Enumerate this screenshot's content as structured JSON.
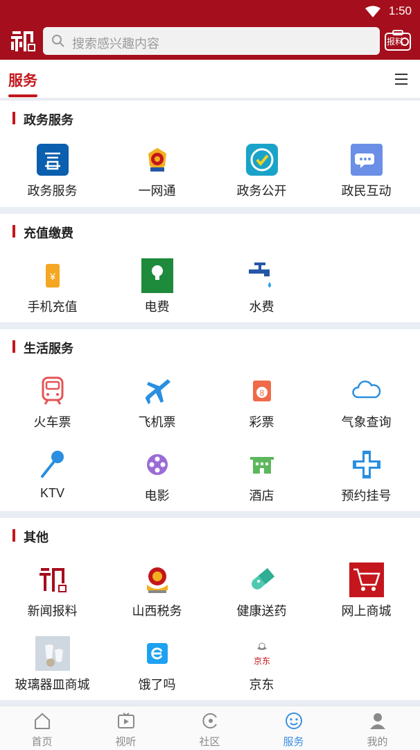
{
  "status": {
    "time": "1:50"
  },
  "header": {
    "search_placeholder": "搜索感兴趣内容",
    "report_label": "报料"
  },
  "tab": {
    "label": "服务"
  },
  "sections": [
    {
      "title": "政务服务",
      "items": [
        {
          "label": "政务服务",
          "icon": "gov-service-icon"
        },
        {
          "label": "一网通",
          "icon": "police-badge-icon"
        },
        {
          "label": "政务公开",
          "icon": "check-circle-icon"
        },
        {
          "label": "政民互动",
          "icon": "chat-bubble-icon"
        }
      ]
    },
    {
      "title": "充值缴费",
      "items": [
        {
          "label": "手机充值",
          "icon": "phone-recharge-icon"
        },
        {
          "label": "电费",
          "icon": "electric-bulb-icon",
          "sub": "电费"
        },
        {
          "label": "水费",
          "icon": "water-tap-icon"
        }
      ]
    },
    {
      "title": "生活服务",
      "items": [
        {
          "label": "火车票",
          "icon": "train-icon"
        },
        {
          "label": "飞机票",
          "icon": "airplane-icon"
        },
        {
          "label": "彩票",
          "icon": "lottery-icon"
        },
        {
          "label": "气象查询",
          "icon": "cloud-icon"
        },
        {
          "label": "KTV",
          "icon": "microphone-icon"
        },
        {
          "label": "电影",
          "icon": "film-reel-icon"
        },
        {
          "label": "酒店",
          "icon": "hotel-icon"
        },
        {
          "label": "预约挂号",
          "icon": "medical-cross-icon"
        }
      ]
    },
    {
      "title": "其他",
      "items": [
        {
          "label": "新闻报料",
          "icon": "news-logo-icon"
        },
        {
          "label": "山西税务",
          "icon": "tax-emblem-icon"
        },
        {
          "label": "健康送药",
          "icon": "pill-icon"
        },
        {
          "label": "网上商城",
          "icon": "shopping-cart-icon"
        },
        {
          "label": "玻璃器皿商城",
          "icon": "glassware-photo-icon"
        },
        {
          "label": "饿了吗",
          "icon": "eleme-icon"
        },
        {
          "label": "京东",
          "icon": "jd-dog-icon",
          "sub": "京东"
        }
      ]
    }
  ],
  "bottom_nav": [
    {
      "label": "首页",
      "icon": "home-icon"
    },
    {
      "label": "视听",
      "icon": "tv-play-icon"
    },
    {
      "label": "社区",
      "icon": "community-icon"
    },
    {
      "label": "服务",
      "icon": "smile-icon",
      "active": true
    },
    {
      "label": "我的",
      "icon": "user-icon"
    }
  ],
  "colors": {
    "brand": "#a50e1c",
    "accent": "#c4161c",
    "active_nav": "#3a8fe0"
  }
}
